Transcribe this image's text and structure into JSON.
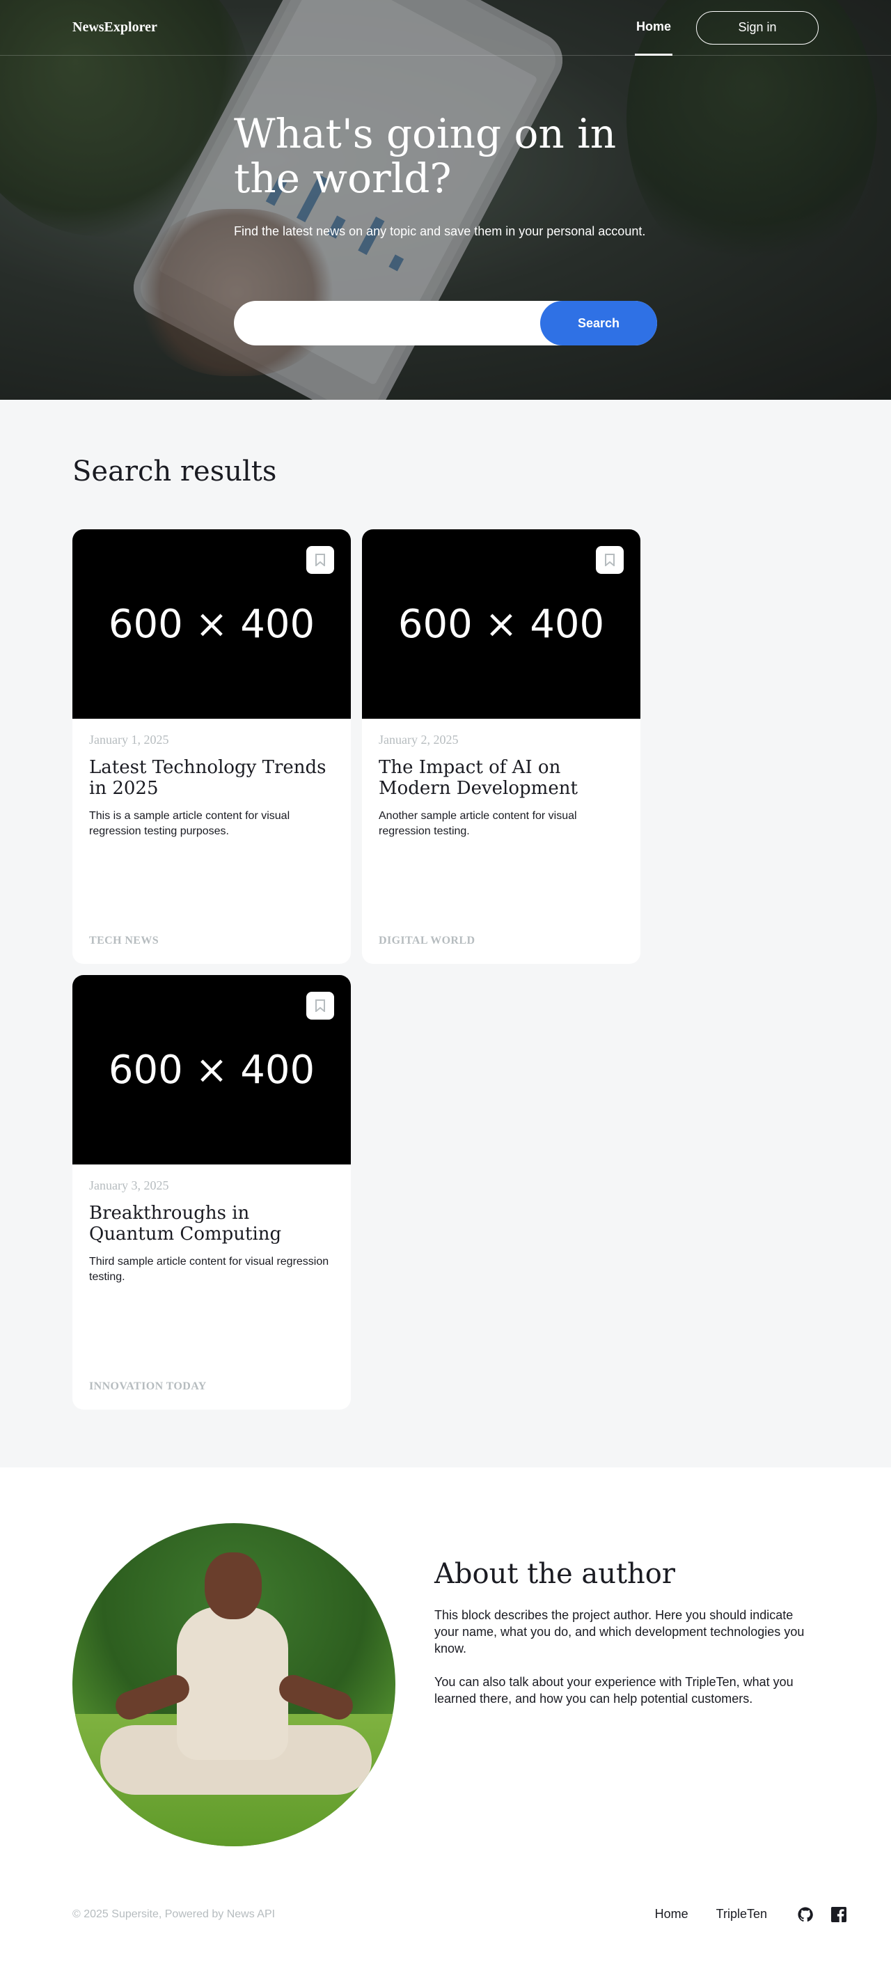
{
  "header": {
    "logo": "NewsExplorer",
    "nav_home": "Home",
    "signin_label": "Sign in"
  },
  "hero": {
    "title": "What's going on in the world?",
    "subtitle": "Find the latest news on any topic and save them in your personal account.",
    "search_placeholder": "",
    "search_button": "Search"
  },
  "results": {
    "title": "Search results",
    "cards": [
      {
        "image_text": "600 × 400",
        "date": "January 1, 2025",
        "title": "Latest Technology Trends in 2025",
        "text": "This is a sample article content for visual regression testing purposes.",
        "source": "TECH NEWS"
      },
      {
        "image_text": "600 × 400",
        "date": "January 2, 2025",
        "title": "The Impact of AI on Modern Development",
        "text": "Another sample article content for visual regression testing.",
        "source": "DIGITAL WORLD"
      },
      {
        "image_text": "600 × 400",
        "date": "January 3, 2025",
        "title": "Breakthroughs in Quantum Computing",
        "text": "Third sample article content for visual regression testing.",
        "source": "INNOVATION TODAY"
      }
    ]
  },
  "about": {
    "title": "About the author",
    "paragraph1": "This block describes the project author. Here you should indicate your name, what you do, and which development technologies you know.",
    "paragraph2": "You can also talk about your experience with TripleTen, what you learned there, and how you can help potential customers."
  },
  "footer": {
    "copyright": "© 2025 Supersite, Powered by News API",
    "link_home": "Home",
    "link_tripleten": "TripleTen",
    "icons": [
      "github-icon",
      "facebook-icon"
    ]
  },
  "colors": {
    "accent": "#2f71e5",
    "muted": "#b6bcbf",
    "text": "#1a1b22",
    "section_bg": "#f5f6f7"
  }
}
